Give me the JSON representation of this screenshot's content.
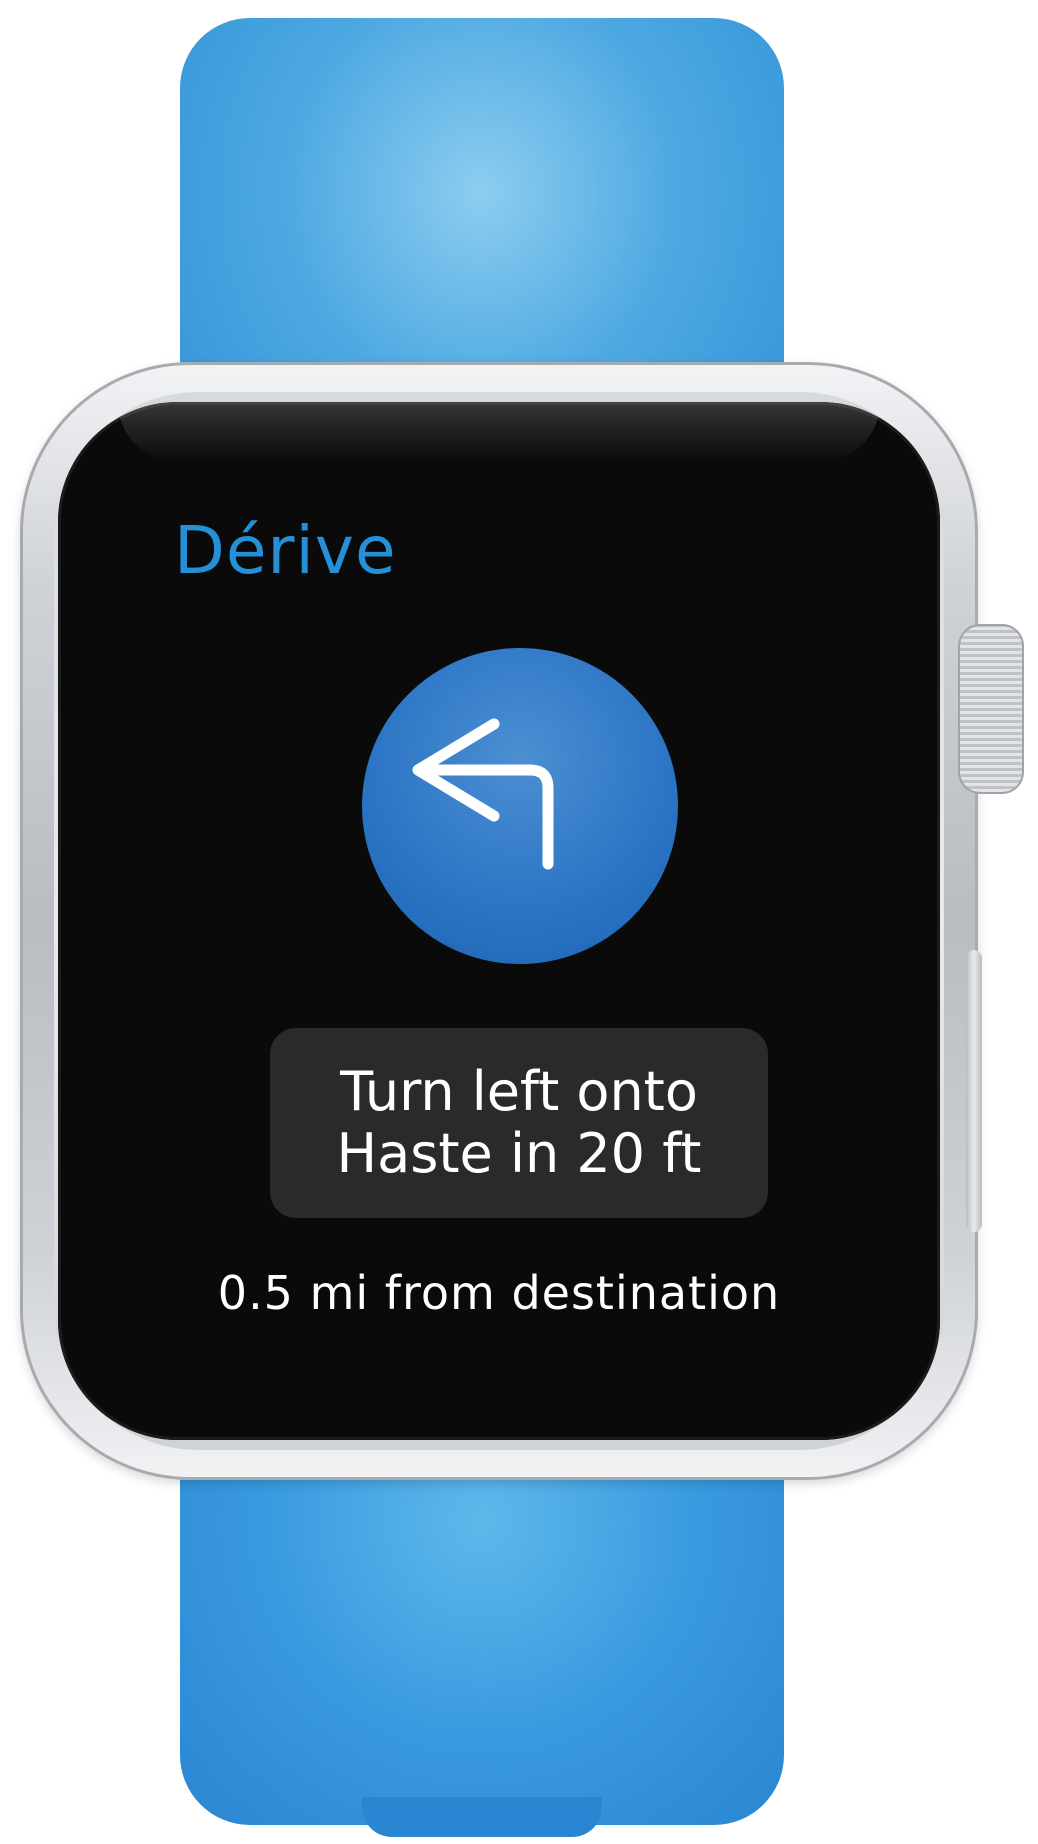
{
  "device": {
    "band_color": "#3a9ae0",
    "case_color": "#c9ccd0"
  },
  "app": {
    "title": "Dérive",
    "accent_color": "#2590d8"
  },
  "navigation": {
    "turn_icon": "turn-left-arrow-icon",
    "instruction_line1": "Turn left onto",
    "instruction_line2": "Haste in 20 ft",
    "distance_text": "0.5 mi from destination"
  }
}
